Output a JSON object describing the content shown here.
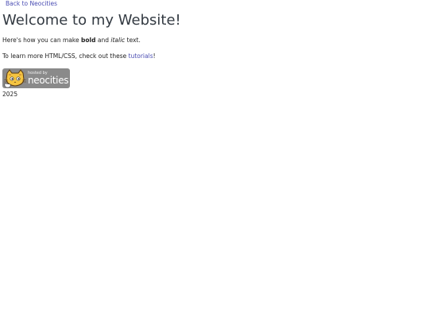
{
  "nav": {
    "back_link": "Back to Neocities"
  },
  "heading": "Welcome to my Website!",
  "paragraph1": {
    "prefix": "Here's how you can make ",
    "bold": "bold",
    "middle": " and ",
    "italic": "italic",
    "suffix": " text."
  },
  "paragraph2": {
    "prefix": "To learn more HTML/CSS, check out these ",
    "link": "tutorials",
    "suffix": "!"
  },
  "badge": {
    "small_text": "hosted by",
    "big_text": "neocities",
    "logo_icon": "neocities-cat-icon"
  },
  "footer": {
    "year": "2025"
  },
  "colors": {
    "link": "#4a4db3",
    "heading": "#333a42",
    "badge_bg": "#8a8a8a",
    "text": "#222222"
  }
}
